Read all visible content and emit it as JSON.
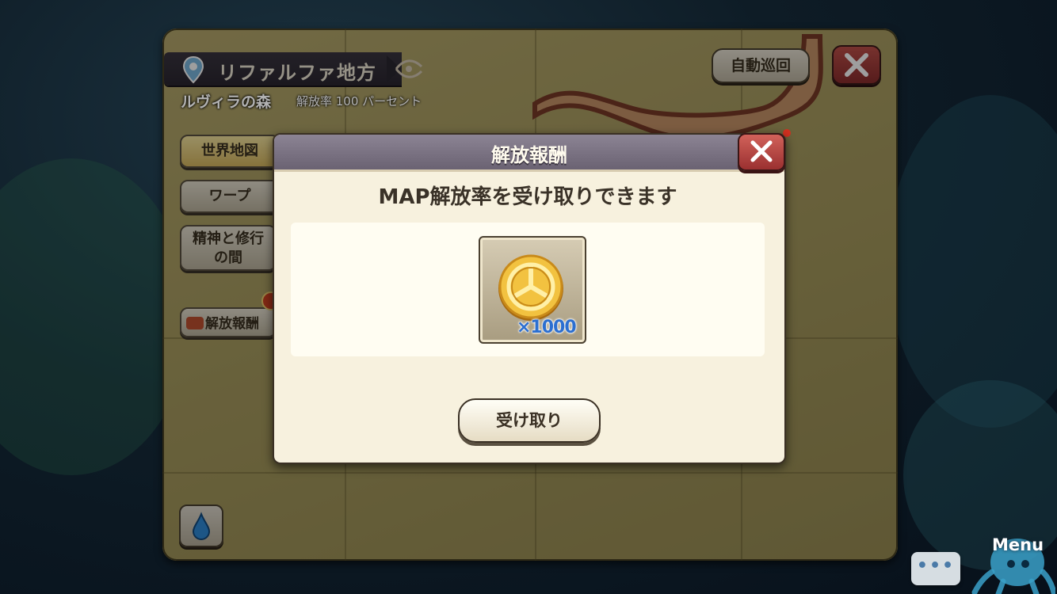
{
  "map": {
    "region_name": "リファルファ地方",
    "area_name": "ルヴィラの森",
    "liberation_rate_text": "解放率 100 パーセント",
    "auto_patrol_label": "自動巡回",
    "close_icon": "close-icon",
    "drop_icon": "water-drop-icon",
    "pin_icon": "location-pin-icon"
  },
  "sidebar": {
    "items": [
      {
        "label": "世界地図"
      },
      {
        "label": "ワープ"
      },
      {
        "label_line1": "精神と修行",
        "label_line2": "の間"
      },
      {
        "label": "解放報酬"
      }
    ]
  },
  "dialog": {
    "title": "解放報酬",
    "message": "MAP解放率を受け取りできます",
    "reward": {
      "icon": "gold-coin-icon",
      "quantity": "×1000"
    },
    "receive_label": "受け取り",
    "close_icon": "close-icon"
  },
  "footer": {
    "chat_icon": "chat-bubble-icon",
    "menu_label": "Menu"
  },
  "colors": {
    "dialog_header": "#7a7282",
    "close_button": "#b0443e",
    "map_parchment": "#ab9f62",
    "quantity_text": "#2c6fd0"
  }
}
